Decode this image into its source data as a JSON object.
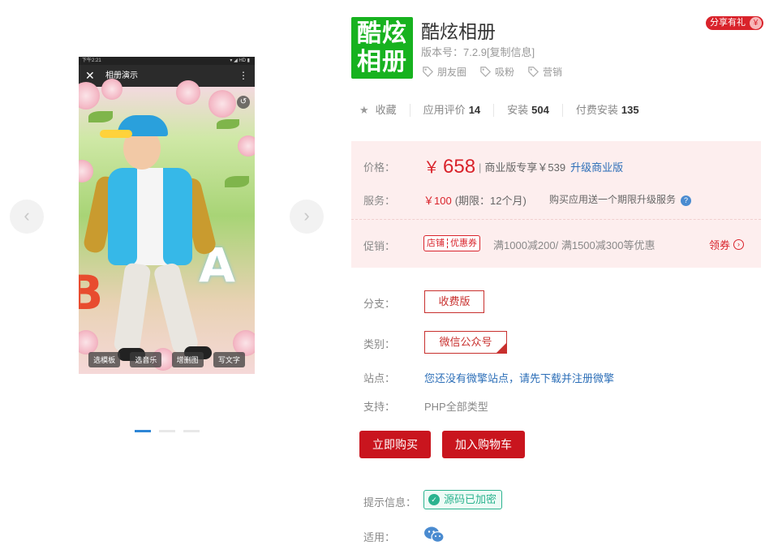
{
  "gallery": {
    "phone_status_left": "下午2:21",
    "phone_status_right": "▾ ◢ HD ▮",
    "phone_title": "相册演示",
    "phone_close": "✕",
    "phone_more": "⋮",
    "phone_buttons": [
      "选模板",
      "选音乐",
      "增删图",
      "写文字"
    ],
    "prev_arrow": "‹",
    "next_arrow": "›",
    "photo_letters": [
      "B",
      "A"
    ]
  },
  "app": {
    "logo_line1": "酷炫",
    "logo_line2": "相册",
    "title": "酷炫相册",
    "version_label": "版本号：",
    "version": "7.2.9",
    "copy_info": "[复制信息]",
    "tags": [
      "朋友圈",
      "吸粉",
      "营销"
    ],
    "share_label": "分享有礼",
    "share_icon": "gift-icon"
  },
  "stats": {
    "favorite_label": "收藏",
    "rating_label": "应用评价",
    "rating_value": "14",
    "install_label": "安装",
    "install_value": "504",
    "paid_install_label": "付费安装",
    "paid_install_value": "135"
  },
  "price": {
    "price_label": "价格：",
    "currency": "￥",
    "price_value": "658",
    "biz_sep": "|",
    "biz_text": "商业版专享￥539",
    "upgrade_label": "升级商业版",
    "service_label": "服务：",
    "service_value": "￥100",
    "service_period": "(期限：12个月)",
    "service_note": "购买应用送一个期限升级服务",
    "promo_label": "促销：",
    "promo_tag_left": "店铺",
    "promo_tag_right": "优惠券",
    "promo_text": "满1000减200/ 满1500减300等优惠",
    "coupon_label": "领券"
  },
  "options": {
    "branch_label": "分支：",
    "branch_value": "收费版",
    "category_label": "类别：",
    "category_value": "微信公众号",
    "site_label": "站点：",
    "site_value": "您还没有微擎站点，请先下载并注册微擎",
    "support_label": "支持：",
    "support_value": "PHP全部类型"
  },
  "actions": {
    "buy_label": "立即购买",
    "cart_label": "加入购物车"
  },
  "info": {
    "hint_label": "提示信息：",
    "secure_label": "源码已加密",
    "applies_label": "适用：",
    "applies_icon": "wechat-icon"
  },
  "colors": {
    "accent_red": "#d9232b",
    "button_red": "#c9151e",
    "link_blue": "#2d6fb8",
    "logo_green": "#17b21f",
    "secure_green": "#2bb38f",
    "price_bg": "#fdeeee"
  }
}
